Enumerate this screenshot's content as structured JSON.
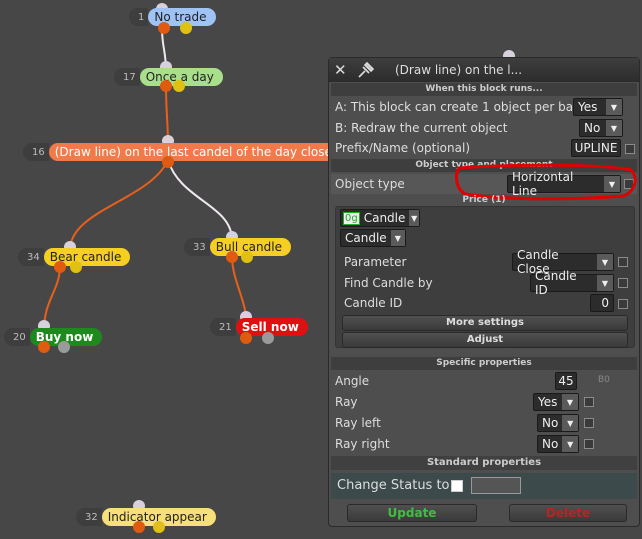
{
  "nodes": {
    "no_trade": {
      "num": "1",
      "label": "No trade",
      "color": "#9fc3f5"
    },
    "once_a_day": {
      "num": "17",
      "label": "Once a day",
      "color": "#a9df8a"
    },
    "draw_line": {
      "num": "16",
      "label": "(Draw line) on the last candel of the day close",
      "color": "#f07a4a"
    },
    "bear_candle": {
      "num": "34",
      "label": "Bear candle",
      "color": "#f5d020"
    },
    "bull_candle": {
      "num": "33",
      "label": "Bull candle",
      "color": "#f5d020"
    },
    "buy_now": {
      "num": "20",
      "label": "Buy now",
      "color": "#1e8a1e"
    },
    "sell_now": {
      "num": "21",
      "label": "Sell now",
      "color": "#e01010"
    },
    "indicator_appear": {
      "num": "32",
      "label": "Indicator appear",
      "color": "#f7df7a"
    }
  },
  "panel": {
    "title": "(Draw line) on the l...",
    "sections": {
      "when_runs": "When this block runs...",
      "object_type": "Object type and placement",
      "price": "Price (1)",
      "specific": "Specific properties",
      "standard": "Standard properties"
    },
    "rows": {
      "a_label": "A: This block can create 1 object per bar",
      "a_value": "Yes",
      "b_label": "B: Redraw the current object",
      "b_value": "No",
      "prefix_label": "Prefix/Name (optional)",
      "prefix_value": "UPLINE",
      "object_type_label": "Object type",
      "object_type_value": "Horizontal Line"
    },
    "price": {
      "candle_sel": "Candle",
      "candle_sel2": "Candle",
      "candle_icon": "0g",
      "parameter_label": "Parameter",
      "parameter_value": "Candle Close",
      "find_label": "Find Candle by",
      "find_value": "Candle ID",
      "candle_id_label": "Candle ID",
      "candle_id_value": "0",
      "more_settings": "More settings",
      "adjust": "Adjust"
    },
    "specific": {
      "angle_label": "Angle",
      "angle_value": "45",
      "angle_unit": "B0",
      "ray_label": "Ray",
      "ray_value": "Yes",
      "ray_left_label": "Ray left",
      "ray_left_value": "No",
      "ray_right_label": "Ray right",
      "ray_right_value": "No"
    },
    "change_status_label": "Change Status to",
    "update": "Update",
    "delete": "Delete"
  },
  "colors": {
    "update_text": "#3fbf3f",
    "delete_text": "#c02020",
    "highlight": "#e00000"
  }
}
